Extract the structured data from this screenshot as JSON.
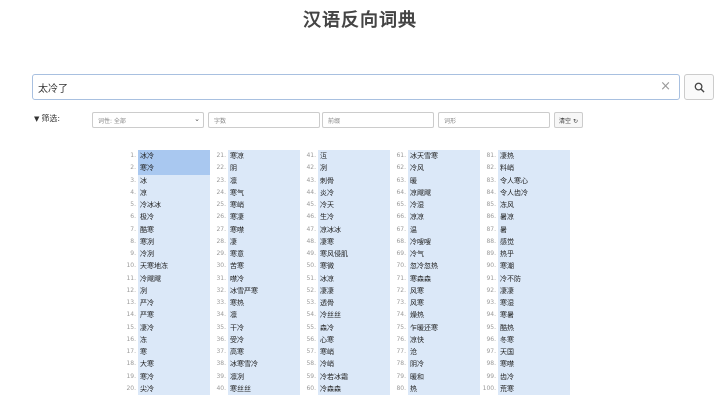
{
  "page_title": "汉语反向词典",
  "search": {
    "value": "太冷了",
    "clear_icon": "×"
  },
  "filter": {
    "label": "筛选:",
    "pos_select": "词性: 全部",
    "field_zishu": "字数",
    "field_qianzhui": "前缀",
    "field_cixing": "词形",
    "clear_label": "清空"
  },
  "results": [
    {
      "n": "1.",
      "w": "冰冷",
      "hl": true
    },
    {
      "n": "2.",
      "w": "寒冷",
      "hl": true
    },
    {
      "n": "3.",
      "w": "冰",
      "hl": false
    },
    {
      "n": "4.",
      "w": "凉",
      "hl": false
    },
    {
      "n": "5.",
      "w": "冷冰冰",
      "hl": false
    },
    {
      "n": "6.",
      "w": "极冷",
      "hl": false
    },
    {
      "n": "7.",
      "w": "酷寒",
      "hl": false
    },
    {
      "n": "8.",
      "w": "寒冽",
      "hl": false
    },
    {
      "n": "9.",
      "w": "冷冽",
      "hl": false
    },
    {
      "n": "10.",
      "w": "天寒地冻",
      "hl": false
    },
    {
      "n": "11.",
      "w": "冷飕飕",
      "hl": false
    },
    {
      "n": "12.",
      "w": "冽",
      "hl": false
    },
    {
      "n": "13.",
      "w": "严冷",
      "hl": false
    },
    {
      "n": "14.",
      "w": "严寒",
      "hl": false
    },
    {
      "n": "15.",
      "w": "凄冷",
      "hl": false
    },
    {
      "n": "16.",
      "w": "冻",
      "hl": false
    },
    {
      "n": "17.",
      "w": "寒",
      "hl": false
    },
    {
      "n": "18.",
      "w": "大寒",
      "hl": false
    },
    {
      "n": "19.",
      "w": "寒冷",
      "hl": false
    },
    {
      "n": "20.",
      "w": "尖冷",
      "hl": false
    },
    {
      "n": "21.",
      "w": "寒凉",
      "hl": false
    },
    {
      "n": "22.",
      "w": "阴",
      "hl": false
    },
    {
      "n": "23.",
      "w": "凛",
      "hl": false
    },
    {
      "n": "24.",
      "w": "寒气",
      "hl": false
    },
    {
      "n": "25.",
      "w": "寒峭",
      "hl": false
    },
    {
      "n": "26.",
      "w": "寒凄",
      "hl": false
    },
    {
      "n": "27.",
      "w": "寒噤",
      "hl": false
    },
    {
      "n": "28.",
      "w": "凄",
      "hl": false
    },
    {
      "n": "29.",
      "w": "寒意",
      "hl": false
    },
    {
      "n": "30.",
      "w": "苦寒",
      "hl": false
    },
    {
      "n": "31.",
      "w": "噤冷",
      "hl": false
    },
    {
      "n": "32.",
      "w": "冰雪严寒",
      "hl": false
    },
    {
      "n": "33.",
      "w": "寒热",
      "hl": false
    },
    {
      "n": "34.",
      "w": "凛",
      "hl": false
    },
    {
      "n": "35.",
      "w": "干冷",
      "hl": false
    },
    {
      "n": "36.",
      "w": "受冷",
      "hl": false
    },
    {
      "n": "37.",
      "w": "高寒",
      "hl": false
    },
    {
      "n": "38.",
      "w": "冰寒雪冷",
      "hl": false
    },
    {
      "n": "39.",
      "w": "凛冽",
      "hl": false
    },
    {
      "n": "40.",
      "w": "寒丝丝",
      "hl": false
    },
    {
      "n": "41.",
      "w": "沍",
      "hl": false
    },
    {
      "n": "42.",
      "w": "冽",
      "hl": false
    },
    {
      "n": "43.",
      "w": "刺骨",
      "hl": false
    },
    {
      "n": "44.",
      "w": "炎冷",
      "hl": false
    },
    {
      "n": "45.",
      "w": "冷天",
      "hl": false
    },
    {
      "n": "46.",
      "w": "生冷",
      "hl": false
    },
    {
      "n": "47.",
      "w": "凉冰冰",
      "hl": false
    },
    {
      "n": "48.",
      "w": "凄寒",
      "hl": false
    },
    {
      "n": "49.",
      "w": "寒风侵肌",
      "hl": false
    },
    {
      "n": "50.",
      "w": "寒微",
      "hl": false
    },
    {
      "n": "51.",
      "w": "冰凉",
      "hl": false
    },
    {
      "n": "52.",
      "w": "凄凄",
      "hl": false
    },
    {
      "n": "53.",
      "w": "透骨",
      "hl": false
    },
    {
      "n": "54.",
      "w": "冷丝丝",
      "hl": false
    },
    {
      "n": "55.",
      "w": "森冷",
      "hl": false
    },
    {
      "n": "56.",
      "w": "心寒",
      "hl": false
    },
    {
      "n": "57.",
      "w": "寒峭",
      "hl": false
    },
    {
      "n": "58.",
      "w": "冷峭",
      "hl": false
    },
    {
      "n": "59.",
      "w": "冷若冰霜",
      "hl": false
    },
    {
      "n": "60.",
      "w": "冷森森",
      "hl": false
    },
    {
      "n": "61.",
      "w": "冰天雪寒",
      "hl": false
    },
    {
      "n": "62.",
      "w": "冷风",
      "hl": false
    },
    {
      "n": "63.",
      "w": "暖",
      "hl": false
    },
    {
      "n": "64.",
      "w": "凉飕飕",
      "hl": false
    },
    {
      "n": "65.",
      "w": "冷湿",
      "hl": false
    },
    {
      "n": "66.",
      "w": "凉凉",
      "hl": false
    },
    {
      "n": "67.",
      "w": "温",
      "hl": false
    },
    {
      "n": "68.",
      "w": "冷嗖嗖",
      "hl": false
    },
    {
      "n": "69.",
      "w": "冷气",
      "hl": false
    },
    {
      "n": "70.",
      "w": "忽冷忽热",
      "hl": false
    },
    {
      "n": "71.",
      "w": "寒森森",
      "hl": false
    },
    {
      "n": "72.",
      "w": "风寒",
      "hl": false
    },
    {
      "n": "73.",
      "w": "风寒",
      "hl": false
    },
    {
      "n": "74.",
      "w": "燥热",
      "hl": false
    },
    {
      "n": "75.",
      "w": "乍暖还寒",
      "hl": false
    },
    {
      "n": "76.",
      "w": "凉快",
      "hl": false
    },
    {
      "n": "77.",
      "w": "沧",
      "hl": false
    },
    {
      "n": "78.",
      "w": "阴冷",
      "hl": false
    },
    {
      "n": "79.",
      "w": "暖和",
      "hl": false
    },
    {
      "n": "80.",
      "w": "热",
      "hl": false
    },
    {
      "n": "81.",
      "w": "凄热",
      "hl": false
    },
    {
      "n": "82.",
      "w": "料峭",
      "hl": false
    },
    {
      "n": "83.",
      "w": "令人寒心",
      "hl": false
    },
    {
      "n": "84.",
      "w": "令人齿冷",
      "hl": false
    },
    {
      "n": "85.",
      "w": "冻风",
      "hl": false
    },
    {
      "n": "86.",
      "w": "暑凉",
      "hl": false
    },
    {
      "n": "87.",
      "w": "暑",
      "hl": false
    },
    {
      "n": "88.",
      "w": "感觉",
      "hl": false
    },
    {
      "n": "89.",
      "w": "热乎",
      "hl": false
    },
    {
      "n": "90.",
      "w": "寒潮",
      "hl": false
    },
    {
      "n": "91.",
      "w": "冷不防",
      "hl": false
    },
    {
      "n": "92.",
      "w": "凄凄",
      "hl": false
    },
    {
      "n": "93.",
      "w": "寒湿",
      "hl": false
    },
    {
      "n": "94.",
      "w": "寒暑",
      "hl": false
    },
    {
      "n": "95.",
      "w": "酷热",
      "hl": false
    },
    {
      "n": "96.",
      "w": "冬寒",
      "hl": false
    },
    {
      "n": "97.",
      "w": "天国",
      "hl": false
    },
    {
      "n": "98.",
      "w": "寒噤",
      "hl": false
    },
    {
      "n": "99.",
      "w": "齿冷",
      "hl": false
    },
    {
      "n": "100.",
      "w": "荒寒",
      "hl": false
    }
  ],
  "colors": {
    "highlight": "#a9c8f0",
    "cell": "#dbe8f8"
  },
  "icons": {
    "search": "search-icon",
    "filter": "filter-icon",
    "refresh": "refresh-icon"
  }
}
